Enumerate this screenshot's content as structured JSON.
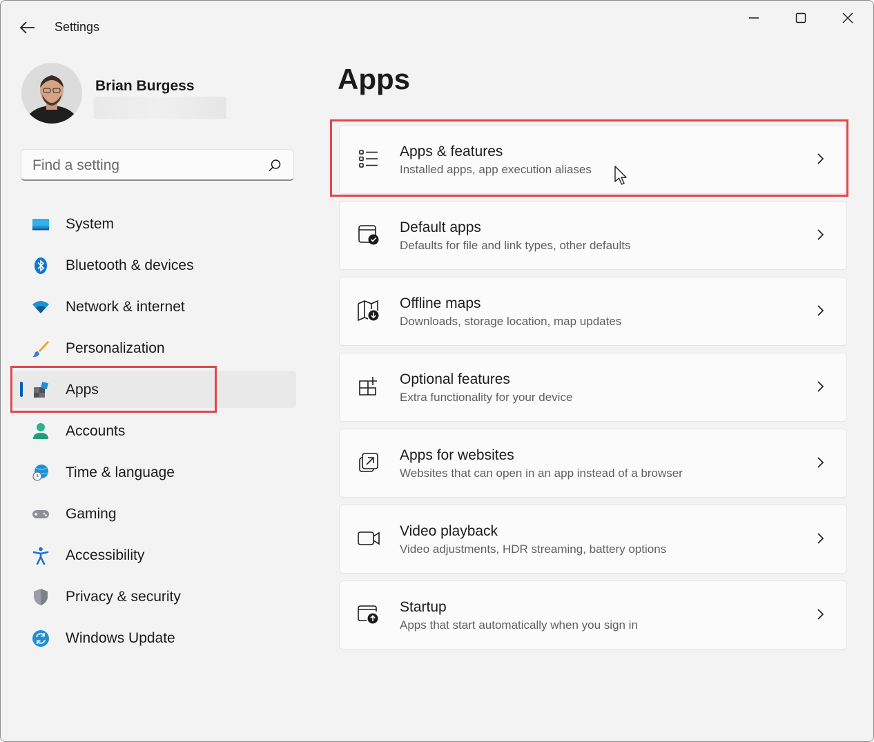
{
  "window": {
    "title": "Settings",
    "controls": {
      "minimize": "minimize-icon",
      "maximize": "maximize-icon",
      "close": "close-icon"
    }
  },
  "profile": {
    "name": "Brian Burgess"
  },
  "search": {
    "placeholder": "Find a setting",
    "value": ""
  },
  "sidebar": {
    "items": [
      {
        "label": "System",
        "icon": "system-icon"
      },
      {
        "label": "Bluetooth & devices",
        "icon": "bluetooth-icon"
      },
      {
        "label": "Network & internet",
        "icon": "wifi-icon"
      },
      {
        "label": "Personalization",
        "icon": "brush-icon"
      },
      {
        "label": "Apps",
        "icon": "apps-icon",
        "selected": true
      },
      {
        "label": "Accounts",
        "icon": "person-icon"
      },
      {
        "label": "Time & language",
        "icon": "globe-clock-icon"
      },
      {
        "label": "Gaming",
        "icon": "gamepad-icon"
      },
      {
        "label": "Accessibility",
        "icon": "accessibility-icon"
      },
      {
        "label": "Privacy & security",
        "icon": "shield-icon"
      },
      {
        "label": "Windows Update",
        "icon": "update-icon"
      }
    ]
  },
  "main": {
    "title": "Apps",
    "cards": [
      {
        "title": "Apps & features",
        "description": "Installed apps, app execution aliases",
        "icon": "list-icon"
      },
      {
        "title": "Default apps",
        "description": "Defaults for file and link types, other defaults",
        "icon": "default-apps-icon"
      },
      {
        "title": "Offline maps",
        "description": "Downloads, storage location, map updates",
        "icon": "map-download-icon"
      },
      {
        "title": "Optional features",
        "description": "Extra functionality for your device",
        "icon": "grid-add-icon"
      },
      {
        "title": "Apps for websites",
        "description": "Websites that can open in an app instead of a browser",
        "icon": "open-in-app-icon"
      },
      {
        "title": "Video playback",
        "description": "Video adjustments, HDR streaming, battery options",
        "icon": "video-icon"
      },
      {
        "title": "Startup",
        "description": "Apps that start automatically when you sign in",
        "icon": "startup-icon"
      }
    ]
  },
  "colors": {
    "accent": "#005fb8",
    "highlight": "#e0474c",
    "background": "#f3f3f3",
    "card": "#fbfbfb"
  }
}
